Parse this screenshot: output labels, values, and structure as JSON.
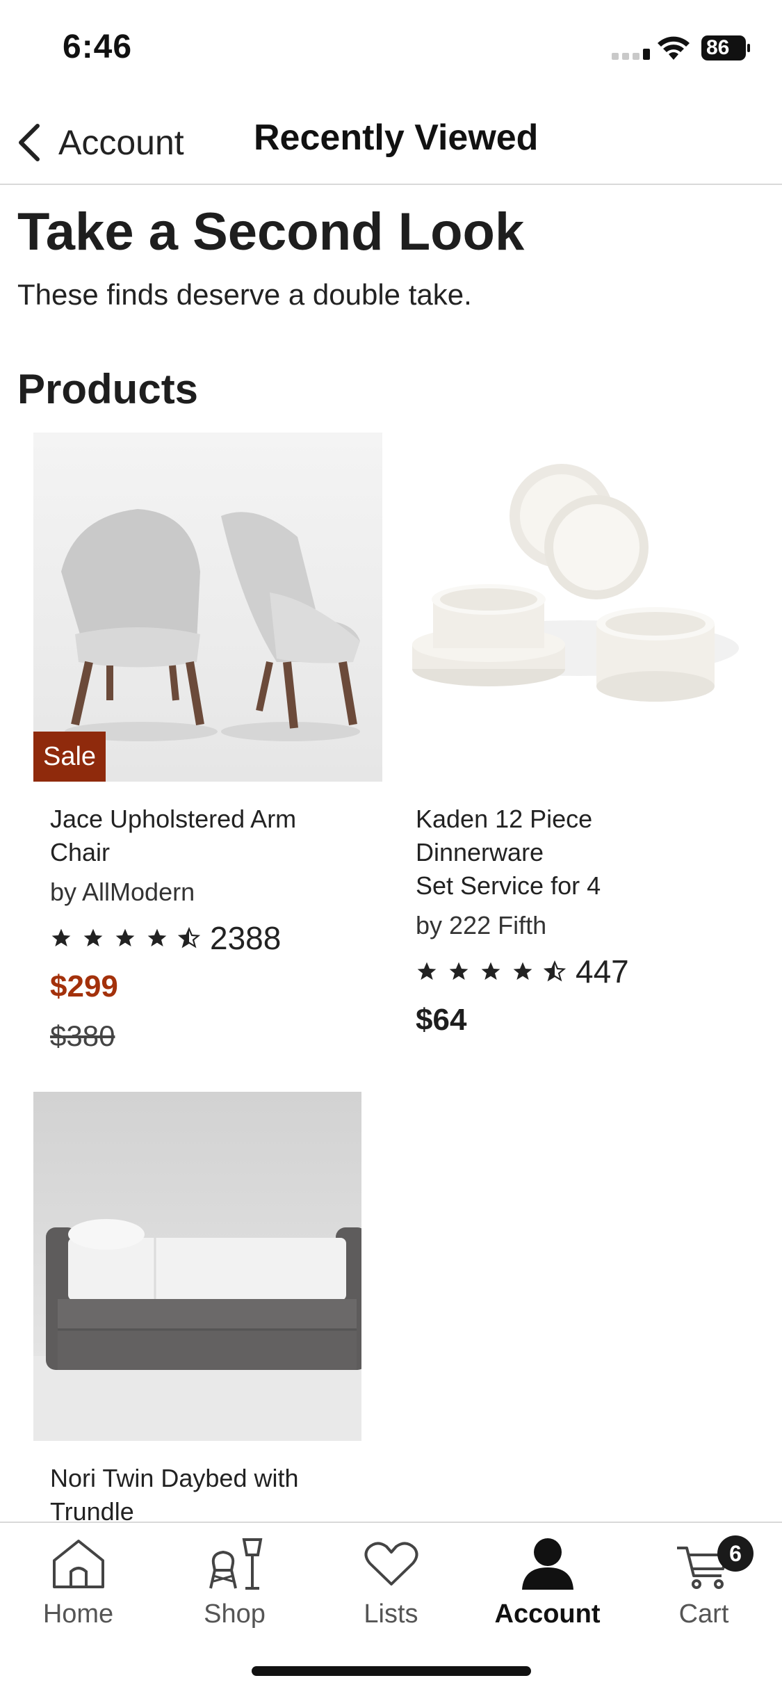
{
  "status_bar": {
    "time": "6:46",
    "battery": "86"
  },
  "nav": {
    "back_label": "Account",
    "title": "Recently Viewed"
  },
  "main": {
    "title": "Take a Second Look",
    "subtitle": "These finds deserve a double take.",
    "section_title": "Products"
  },
  "products": [
    {
      "name_line1": "Jace Upholstered Arm",
      "name_line2": "Chair",
      "brand": "by AllModern",
      "rating": 4.5,
      "review_count": "2388",
      "price": "$299",
      "original_price": "$380",
      "badge": "Sale",
      "image": "gray-arm-chairs"
    },
    {
      "name_line1": "Kaden 12 Piece Dinnerware",
      "name_line2": "Set Service for 4",
      "brand": "by 222 Fifth",
      "rating": 4.5,
      "review_count": "447",
      "price": "$64",
      "image": "white-dinnerware-set"
    },
    {
      "name_line1": "Nori Twin Daybed with",
      "name_line2": "Trundle",
      "image": "gray-daybed"
    }
  ],
  "tabs": [
    {
      "label": "Home",
      "icon": "home-icon"
    },
    {
      "label": "Shop",
      "icon": "shop-icon"
    },
    {
      "label": "Lists",
      "icon": "heart-icon"
    },
    {
      "label": "Account",
      "icon": "account-icon",
      "active": true
    },
    {
      "label": "Cart",
      "icon": "cart-icon",
      "badge": "6"
    }
  ],
  "colors": {
    "sale_badge": "#8f2a0c",
    "sale_price": "#a3310b"
  }
}
